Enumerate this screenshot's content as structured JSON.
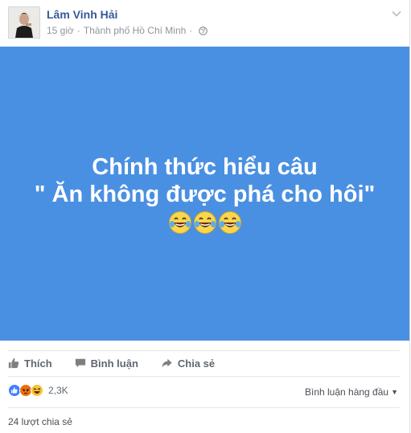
{
  "post": {
    "author": "Lâm Vinh Hải",
    "time": "15 giờ",
    "location": "Thành phố Hồ Chí Minh",
    "privacy_icon": "globe-icon",
    "image_text": {
      "line1": "Chính thức hiểu câu",
      "line2": "\" Ăn không được phá cho hôi\"",
      "emoji": [
        "laughing-tears-emoji",
        "laughing-tears-emoji",
        "laughing-tears-emoji"
      ]
    },
    "image_background": "#4a90e2"
  },
  "actions": {
    "like": "Thích",
    "comment": "Bình luận",
    "share": "Chia sẻ"
  },
  "reactions": {
    "types": [
      "like",
      "angry",
      "haha"
    ],
    "count": "2,3K"
  },
  "comments_sort": "Bình luận hàng đầu",
  "shares_text": "24 lượt chia sẻ",
  "colors": {
    "link": "#365899",
    "accent": "#4a90e2",
    "muted": "#90949c"
  }
}
